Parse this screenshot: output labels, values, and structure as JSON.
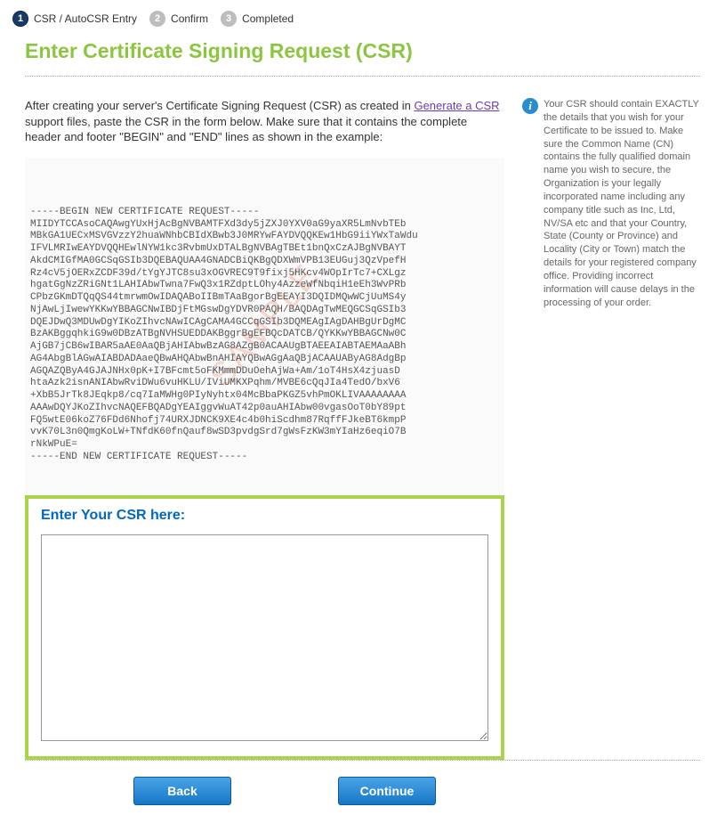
{
  "steps": [
    {
      "num": "1",
      "label": "CSR / AutoCSR Entry",
      "active": true
    },
    {
      "num": "2",
      "label": "Confirm",
      "active": false
    },
    {
      "num": "3",
      "label": "Completed",
      "active": false
    }
  ],
  "title": "Enter Certificate Signing Request (CSR)",
  "intro": {
    "before_link": "After creating your server's Certificate Signing Request (CSR) as created in ",
    "link_text": "Generate a CSR",
    "after_link": " support files, paste the CSR in the form below. Make sure that it contains the complete header and footer \"BEGIN\" and \"END\" lines as shown in the example:"
  },
  "sample": "-----BEGIN NEW CERTIFICATE REQUEST-----\nMIIDYTCCAsoCAQAwgYUxHjAcBgNVBAMTFXd3dy5jZXJ0YXV0aG9yaXR5LmNvbTEb\nMBkGA1UECxMSVGVzzY2huaWNhbCBIdXBwb3J0MRYwFAYDVQQKEw1HbG9iiYWxTaWdu\nIFVLMRIwEAYDVQQHEwlNYW1kc3RvbmUxDTALBgNVBAgTBEt1bnQxCzAJBgNVBAYT\nAkdCMIGfMA0GCSqGSIb3DQEBAQUAA4GNADCBiQKBgQDXWmVPB13EUGuj3QzVpefH\nRz4cV5jOERxZCDF39d/tYgYJTC8su3xOGVREC9T9fixj5HKcv4WOpIrTc7+CXLgz\nhgatGgNzZRiGNt1LAHIAbwTwna7FwQ3x1RZdptLOhy4AzzeWfNbqiH1eEh3WvPRb\nCPbzGKmDTQqQS44tmrwmOwIDAQABoIIBmTAaBgorBgEEAYI3DQIDMQwWCjUuMS4y\nNjAwLjIwewYKKwYBBAGCNwIBDjFtMGswDgYDVR0PAQH/BAQDAgTwMEQGCSqGSIb3\nDQEJDwQ3MDUwDgYIKoZIhvcNAwICAgCAMA4GCCqGSIb3DQMEAgIAgDAHBgUrDgMC\nBzAKBggqhkiG9w0DBzATBgNVHSUEDDAKBggrBgEFBQcDATCB/QYKKwYBBAGCNw0C\nAjGB7jCB6wIBAR5aAE0AaQBjAHIAbwBzAG8AZgB0ACAAUgBTAEEAIABTAEMAaABh\nAG4AbgBlAGwAIABDADAaeQBwAHQAbwBnAHIAYQBwAGgAaQBjACAAUAByAG8AdgBp\nAGQAZQByA4GJAJNHx0pK+I7BFcmt5oFKMmmDDuOehAjWa+Am/1oT4HsX4zjuasD\nhtaAzk2isnANIAbwRviDWu6vuHKLU/IViUMKXPqhm/MVBE6cQqJIa4TedO/bxV6\n+XbB5JrTk8JEqkp8/cq7IaMWHg0PIyNyhtx04McBbaPKGZ5vhPmOKLIVAAAAAAAA\nAAAwDQYJKoZIhvcNAQEFBQADgYEAIggvWuAT42p0auAHIAbw00vgasOoT0bY89pt\nFQ5wtE06koZ76FDd6Nhofj74URXJDNCK9XE4c4b0hiScdhm87RqffFJkeBT6kmpP\nvvK70L3n0QmgKoLW+TNfdK60fnQauf8wSD3pvdgSrd7gWsFzKW3mYIaHz6eqiO7B\nrNkWPuE=\n-----END NEW CERTIFICATE REQUEST-----",
  "watermark": "SAMPLE",
  "csr_box_label": "Enter Your CSR here:",
  "csr_value": "",
  "info_text": "Your CSR should contain EXACTLY the details that you wish for your Certificate to be issued to. Make sure the Common Name (CN) contains the fully qualified domain name you wish to secure, the Organization is your legally incorporated name including any company title such as Inc, Ltd, NV/SA etc and that your Country, State (County or Province) and Locality (City or Town) match the details for your registered company office. Providing incorrect information will cause delays in the processing of your order.",
  "buttons": {
    "back": "Back",
    "continue": "Continue"
  }
}
